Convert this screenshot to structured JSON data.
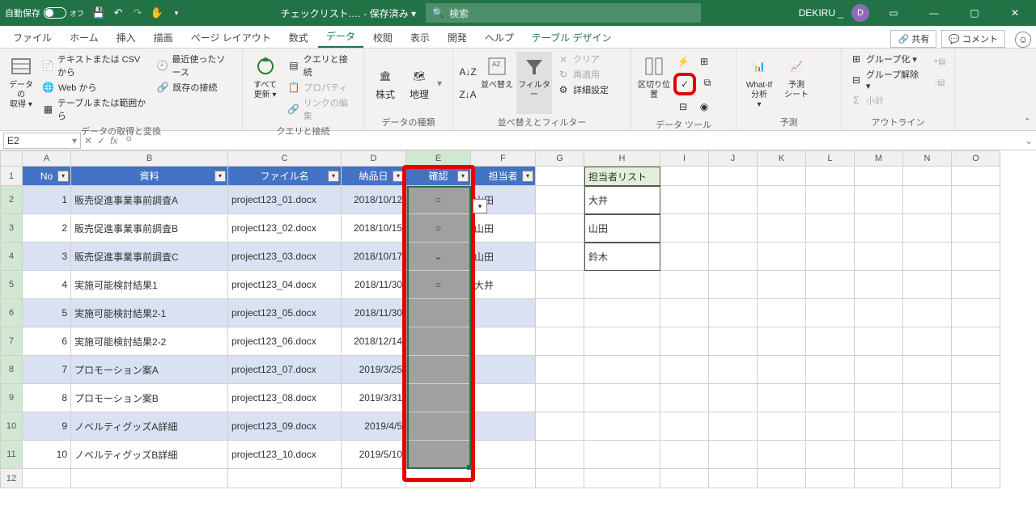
{
  "titlebar": {
    "autosave_label": "自動保存",
    "autosave_state": "オフ",
    "filename": "チェックリスト.… - 保存済み ▾",
    "search_placeholder": "検索",
    "username": "DEKIRU _",
    "avatar_initial": "D"
  },
  "tabs": {
    "items": [
      "ファイル",
      "ホーム",
      "挿入",
      "描画",
      "ページ レイアウト",
      "数式",
      "データ",
      "校閲",
      "表示",
      "開発",
      "ヘルプ",
      "テーブル デザイン"
    ],
    "share": "共有",
    "comment": "コメント"
  },
  "ribbon": {
    "group1": {
      "big": "データの\n取得 ▾",
      "items": [
        "テキストまたは CSV から",
        "Web から",
        "テーブルまたは範囲から",
        "最近使ったソース",
        "既存の接続"
      ],
      "label": "データの取得と変換"
    },
    "group2": {
      "big": "すべて\n更新 ▾",
      "items": [
        "クエリと接続",
        "プロパティ",
        "リンクの編集"
      ],
      "label": "クエリと接続"
    },
    "group3": {
      "btnA": "株式",
      "btnB": "地理",
      "label": "データの種類"
    },
    "group4": {
      "sort": "並べ替え",
      "filter": "フィルター",
      "items": [
        "クリア",
        "再適用",
        "詳細設定"
      ],
      "label": "並べ替えとフィルター"
    },
    "group5": {
      "btn": "区切り位置",
      "label": "データ ツール"
    },
    "group6": {
      "btnA": "What-If 分析\n▾",
      "btnB": "予測\nシート",
      "label": "予測"
    },
    "group7": {
      "items": [
        "グループ化 ▾",
        "グループ解除 ▾",
        "小計"
      ],
      "label": "アウトライン"
    }
  },
  "formulabar": {
    "name": "E2",
    "value": "○"
  },
  "columns": [
    "A",
    "B",
    "C",
    "D",
    "E",
    "F",
    "G",
    "H",
    "I",
    "J",
    "K",
    "L",
    "M",
    "N",
    "O"
  ],
  "header_row": [
    "No",
    "資料",
    "ファイル名",
    "納品日",
    "確認",
    "担当者"
  ],
  "list_header": "担当者リスト",
  "table": [
    {
      "no": 1,
      "doc": "販売促進事業事前調査A",
      "file": "project123_01.docx",
      "date": "2018/10/12",
      "check": "○",
      "person": "山田"
    },
    {
      "no": 2,
      "doc": "販売促進事業事前調査B",
      "file": "project123_02.docx",
      "date": "2018/10/15",
      "check": "○",
      "person": "山田"
    },
    {
      "no": 3,
      "doc": "販売促進事業事前調査C",
      "file": "project123_03.docx",
      "date": "2018/10/17",
      "check": "⌄",
      "person": "山田"
    },
    {
      "no": 4,
      "doc": "実施可能検討結果1",
      "file": "project123_04.docx",
      "date": "2018/11/30",
      "check": "○",
      "person": "大井"
    },
    {
      "no": 5,
      "doc": "実施可能検討結果2-1",
      "file": "project123_05.docx",
      "date": "2018/11/30",
      "check": "",
      "person": ""
    },
    {
      "no": 6,
      "doc": "実施可能検討結果2-2",
      "file": "project123_06.docx",
      "date": "2018/12/14",
      "check": "",
      "person": ""
    },
    {
      "no": 7,
      "doc": "プロモーション案A",
      "file": "project123_07.docx",
      "date": "2019/3/25",
      "check": "",
      "person": ""
    },
    {
      "no": 8,
      "doc": "プロモーション案B",
      "file": "project123_08.docx",
      "date": "2019/3/31",
      "check": "",
      "person": ""
    },
    {
      "no": 9,
      "doc": "ノベルティグッズA詳細",
      "file": "project123_09.docx",
      "date": "2019/4/5",
      "check": "",
      "person": ""
    },
    {
      "no": 10,
      "doc": "ノベルティグッズB詳細",
      "file": "project123_10.docx",
      "date": "2019/5/10",
      "check": "",
      "person": ""
    }
  ],
  "list": [
    "大井",
    "山田",
    "鈴木"
  ]
}
